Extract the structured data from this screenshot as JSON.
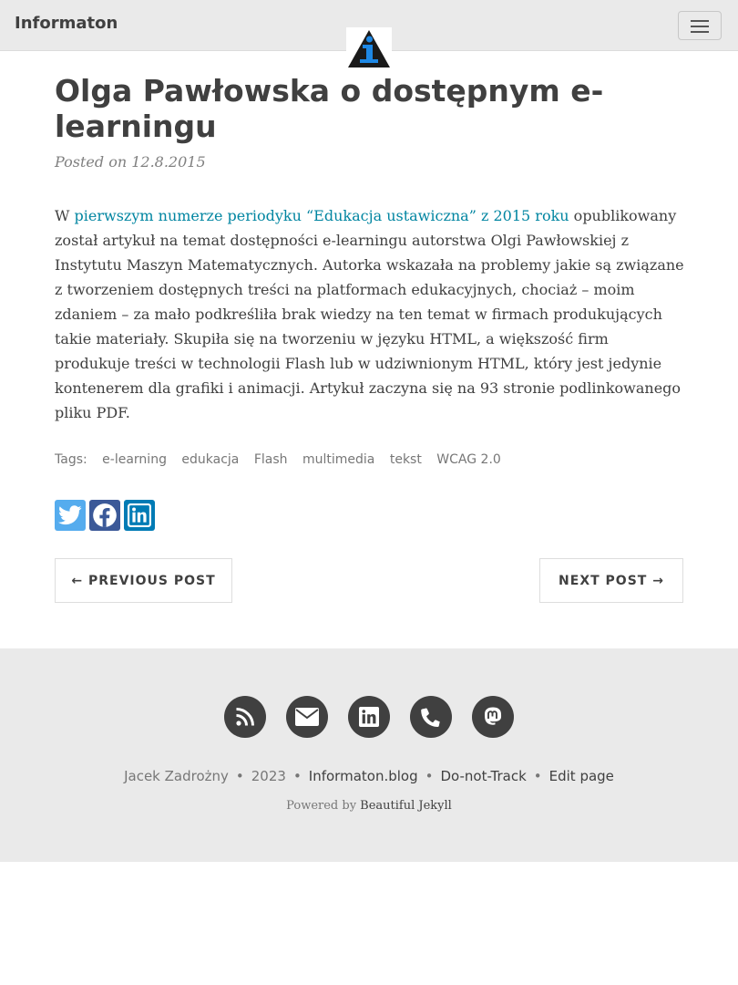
{
  "navbar": {
    "brand": "Informaton",
    "menu_icon": "hamburger-menu-icon"
  },
  "colors": {
    "link": "#0085a1",
    "nav_bg": "#eaeaea",
    "twitter": "#55acee",
    "facebook": "#3b5998",
    "linkedin": "#007bb5",
    "logo_blue": "#1e88e5"
  },
  "post": {
    "title": "Olga Pawłowska o dostępnym e-learningu",
    "posted_on": "Posted on 12.8.2015",
    "body_prefix": "W ",
    "body_link": "pierwszym numerze periodyku “Edukacja ustawiczna” z 2015 roku",
    "body_rest": " opublikowany został artykuł na temat dostępności e-learningu autorstwa Olgi Pawłowskiej z Instytutu Maszyn Matematycznych. Autorka wskazała na problemy jakie są związane z tworzeniem dostępnych treści na platformach edukacyjnych, chociaż – moim zdaniem – za mało podkreśliła brak wiedzy na ten temat w firmach produkujących takie materiały. Skupiła się na tworzeniu w języku HTML, a większość firm produkuje treści w technologii Flash lub w udziwnionym HTML, który jest jedynie kontenerem dla grafiki i animacji. Artykuł zaczyna się na 93 stronie podlinkowanego pliku PDF."
  },
  "tags": {
    "label": "Tags:",
    "items": [
      "e-learning",
      "edukacja",
      "Flash",
      "multimedia",
      "tekst",
      "WCAG 2.0"
    ]
  },
  "share": {
    "icons": [
      "twitter-icon",
      "facebook-icon",
      "linkedin-icon"
    ]
  },
  "pager": {
    "previous": "← PREVIOUS POST",
    "next": "NEXT POST →"
  },
  "footer": {
    "social_icons": [
      "rss-icon",
      "envelope-icon",
      "linkedin-icon",
      "phone-icon",
      "mastodon-icon"
    ],
    "author": "Jacek Zadrożny",
    "year": "2023",
    "site": "Informaton.blog",
    "dnt": "Do-not-Track",
    "edit": "Edit page",
    "separator": "•",
    "powered_prefix": "Powered by ",
    "powered_link": "Beautiful Jekyll"
  }
}
